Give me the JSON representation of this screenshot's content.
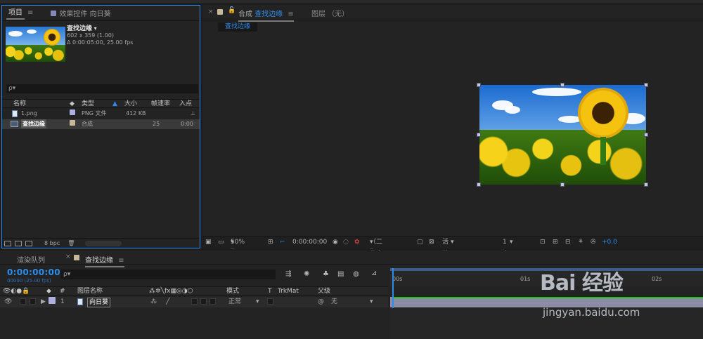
{
  "project_panel": {
    "tab_project": "项目",
    "tab_effects": "效果控件 向日葵",
    "item_name": "查找边缘",
    "item_size": "602 x 359 (1.00)",
    "item_duration": "Δ 0:00:05:00, 25.00 fps",
    "search_placeholder": "ρ▾",
    "columns": {
      "name": "名称",
      "type": "类型",
      "size": "大小",
      "rate": "帧速率",
      "in": "入点"
    },
    "rows": [
      {
        "name": "1.png",
        "type": "PNG 文件",
        "size": "412 KB",
        "rate": "",
        "in": ""
      },
      {
        "name": "查找边缘",
        "type": "合成",
        "size": "",
        "rate": "25",
        "in": "0:00"
      }
    ],
    "bpc": "8 bpc",
    "colors": {
      "png_label": "#b0b0e0",
      "comp_label": "#c8b89a"
    }
  },
  "comp_panel": {
    "tab_label_prefix": "合成",
    "tab_comp_name": "查找边缘",
    "tab_layer": "图层 （无）",
    "subtab": "查找边缘",
    "zoom": "50%",
    "timecode": "0:00:00:00",
    "resolution": "（二分之一）",
    "camera": "活动摄像机",
    "views": "1 个...",
    "exposure": "+0.0"
  },
  "timeline": {
    "tab_render": "渲染队列",
    "tab_comp": "查找边缘",
    "current_time": "0:00:00:00",
    "fps_label": "00000 (25.00 fps)",
    "search_placeholder": "ρ▾",
    "columns": {
      "num": "#",
      "layer_name": "图层名称",
      "mode": "模式",
      "t": "T",
      "trkmat": "TrkMat",
      "parent": "父级"
    },
    "layer": {
      "num": "1",
      "name": "向日葵",
      "mode": "正常",
      "parent": "无"
    },
    "ruler": {
      "t0": "00s",
      "t1": "01s",
      "t2": "02s"
    }
  },
  "watermark": {
    "logo_text": "Bai 经验",
    "url": "jingyan.baidu.com"
  }
}
